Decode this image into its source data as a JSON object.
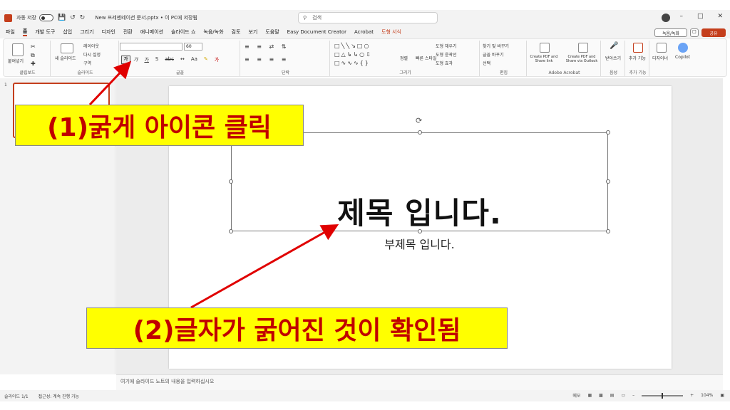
{
  "titlebar": {
    "autosave": "자동 저장",
    "toggle_state": "끔",
    "doc_name": "New 프레젠테이션 문서.pptx • 이 PC에 저장됨",
    "search_placeholder": "검색"
  },
  "menu": {
    "tabs": [
      "파일",
      "홈",
      "개발 도구",
      "삽입",
      "그리기",
      "디자인",
      "전환",
      "애니메이션",
      "슬라이드 쇼",
      "녹음/녹화",
      "검토",
      "보기",
      "도움말",
      "Easy Document Creator",
      "Acrobat",
      "도형 서식"
    ],
    "record_btn": "녹음/녹화",
    "share_btn": "공유"
  },
  "ribbon": {
    "clipboard": {
      "paste": "붙여넣기",
      "label": "클립보드"
    },
    "slides": {
      "new_slide": "새 슬라이드",
      "layout": "레이아웃",
      "reset": "다시 설정",
      "section": "구역",
      "label": "슬라이드"
    },
    "font": {
      "size": "60",
      "bold": "가",
      "label": "글꼴"
    },
    "paragraph": {
      "label": "단락"
    },
    "drawing": {
      "arrange": "정렬",
      "quick_styles": "빠른 스타일",
      "fill": "도형 채우기",
      "outline": "도형 윤곽선",
      "effects": "도형 효과",
      "label": "그리기"
    },
    "editing": {
      "find": "찾기 및 바꾸기",
      "replace": "글꼴 바꾸기",
      "select": "선택",
      "label": "편집"
    },
    "acrobat": {
      "create_share": "Create PDF and Share link",
      "create_outlook": "Create PDF and Share via Outlook",
      "label": "Adobe Acrobat"
    },
    "voice": {
      "dictate": "받아쓰기",
      "label": "음성"
    },
    "addins": {
      "addins": "추가 기능",
      "label": "추가 기능"
    },
    "designer": {
      "designer": "디자이너",
      "copilot": "Copilot"
    }
  },
  "thumbnails": {
    "slide_number": "1"
  },
  "slide": {
    "title": "제목 입니다.",
    "subtitle": "부제목 입니다."
  },
  "notes_placeholder": "여기에 슬라이드 노트의 내용을 입력하십시오",
  "statusbar": {
    "slide_info": "슬라이드 1/1",
    "accessibility": "접근성: 계속 진행 가능",
    "notes": "메모",
    "zoom": "104%"
  },
  "annotations": {
    "step1": "(1)굵게 아이콘 클릭",
    "step2": "(2)글자가 굵어진 것이 확인됨"
  },
  "colors": {
    "accent": "#c43e1c",
    "callout_bg": "#ffff00",
    "callout_text": "#c00000",
    "arrow": "#e00000"
  }
}
